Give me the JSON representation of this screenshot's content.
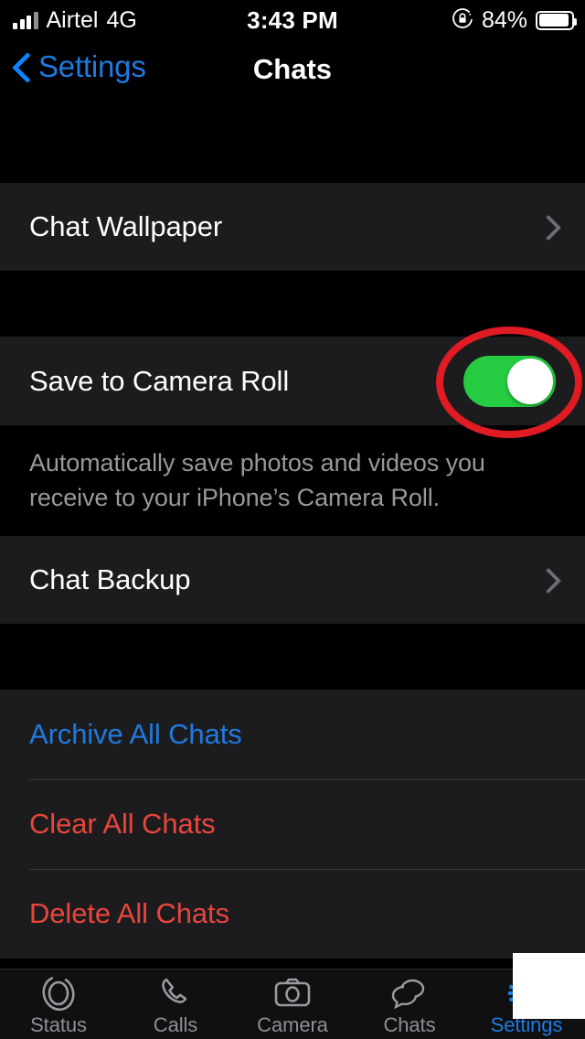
{
  "status_bar": {
    "carrier": "Airtel",
    "network_type": "4G",
    "time": "3:43 PM",
    "battery_percent": "84%",
    "orientation_lock_icon": "rotation-lock-icon",
    "signal_icon": "cellular-signal-icon",
    "battery_icon": "battery-icon"
  },
  "nav": {
    "back_label": "Settings",
    "back_icon": "chevron-left-icon",
    "title": "Chats"
  },
  "sections": {
    "wallpaper": {
      "label": "Chat Wallpaper",
      "accessory_icon": "chevron-right-icon"
    },
    "camera_roll": {
      "label": "Save to Camera Roll",
      "toggle_state": "on",
      "footer": "Automatically save photos and videos you receive to your iPhone’s Camera Roll."
    },
    "backup": {
      "label": "Chat Backup",
      "accessory_icon": "chevron-right-icon"
    },
    "actions": [
      {
        "label": "Archive All Chats",
        "color": "#1f7ae0"
      },
      {
        "label": "Clear All Chats",
        "color": "#e9453d"
      },
      {
        "label": "Delete All Chats",
        "color": "#e9453d"
      }
    ]
  },
  "tab_bar": {
    "items": [
      {
        "label": "Status",
        "icon": "status-rings-icon",
        "active": false
      },
      {
        "label": "Calls",
        "icon": "phone-icon",
        "active": false
      },
      {
        "label": "Camera",
        "icon": "camera-icon",
        "active": false
      },
      {
        "label": "Chats",
        "icon": "speech-bubbles-icon",
        "active": false
      },
      {
        "label": "Settings",
        "icon": "gear-icon",
        "active": true
      }
    ]
  },
  "annotations": {
    "highlight_color": "#e01b24",
    "highlight_target": "Save to Camera Roll toggle",
    "redaction_color": "#ffffff"
  },
  "colors": {
    "background": "#000000",
    "row_background": "#1c1c1e",
    "accent_blue": "#1f7ae0",
    "destructive_red": "#e9453d",
    "toggle_on_green": "#26cc41",
    "secondary_text": "#98989d"
  }
}
